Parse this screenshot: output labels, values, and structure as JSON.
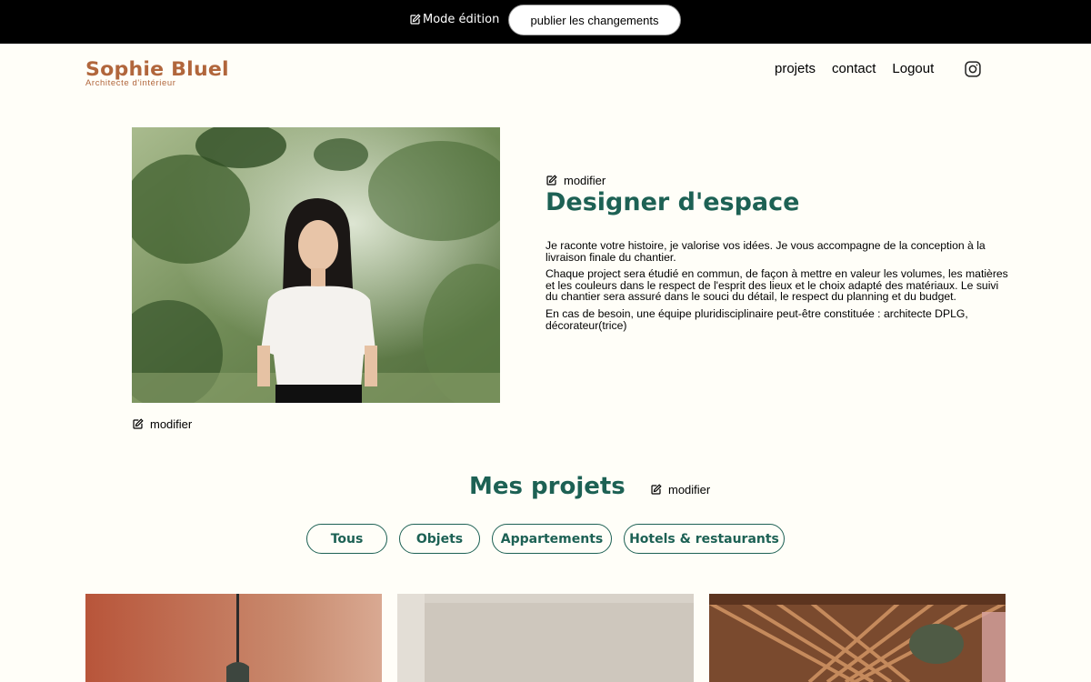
{
  "edit_bar": {
    "mode_label": "Mode édition",
    "publish_label": "publier les changements"
  },
  "header": {
    "logo_name": "Sophie Bluel",
    "logo_sub": "Architecte d'intérieur",
    "nav": [
      "projets",
      "contact",
      "Logout"
    ],
    "icons": [
      "instagram-icon"
    ]
  },
  "intro": {
    "modify_label": "modifier",
    "photo_modify_label": "modifier",
    "title": "Designer d'espace",
    "paragraphs": [
      "Je raconte votre histoire, je valorise vos idées. Je vous accompagne de la conception à la livraison finale du chantier.",
      "Chaque project sera étudié en commun, de façon à mettre en valeur les volumes, les matières et les couleurs dans le respect de l'esprit des lieux et le choix adapté des matériaux. Le suivi du chantier sera assuré dans le souci du détail, le respect du planning et du budget.",
      "En cas de besoin, une équipe pluridisciplinaire peut-être constituée : architecte DPLG, décorateur(trice)"
    ]
  },
  "projects": {
    "title": "Mes projets",
    "modify_label": "modifier",
    "filters": [
      "Tous",
      "Objets",
      "Appartements",
      "Hotels & restaurants"
    ]
  },
  "colors": {
    "accent": "#1d6154",
    "brand": "#b1663c",
    "background": "#fffef8",
    "edit_bar": "#000000"
  }
}
